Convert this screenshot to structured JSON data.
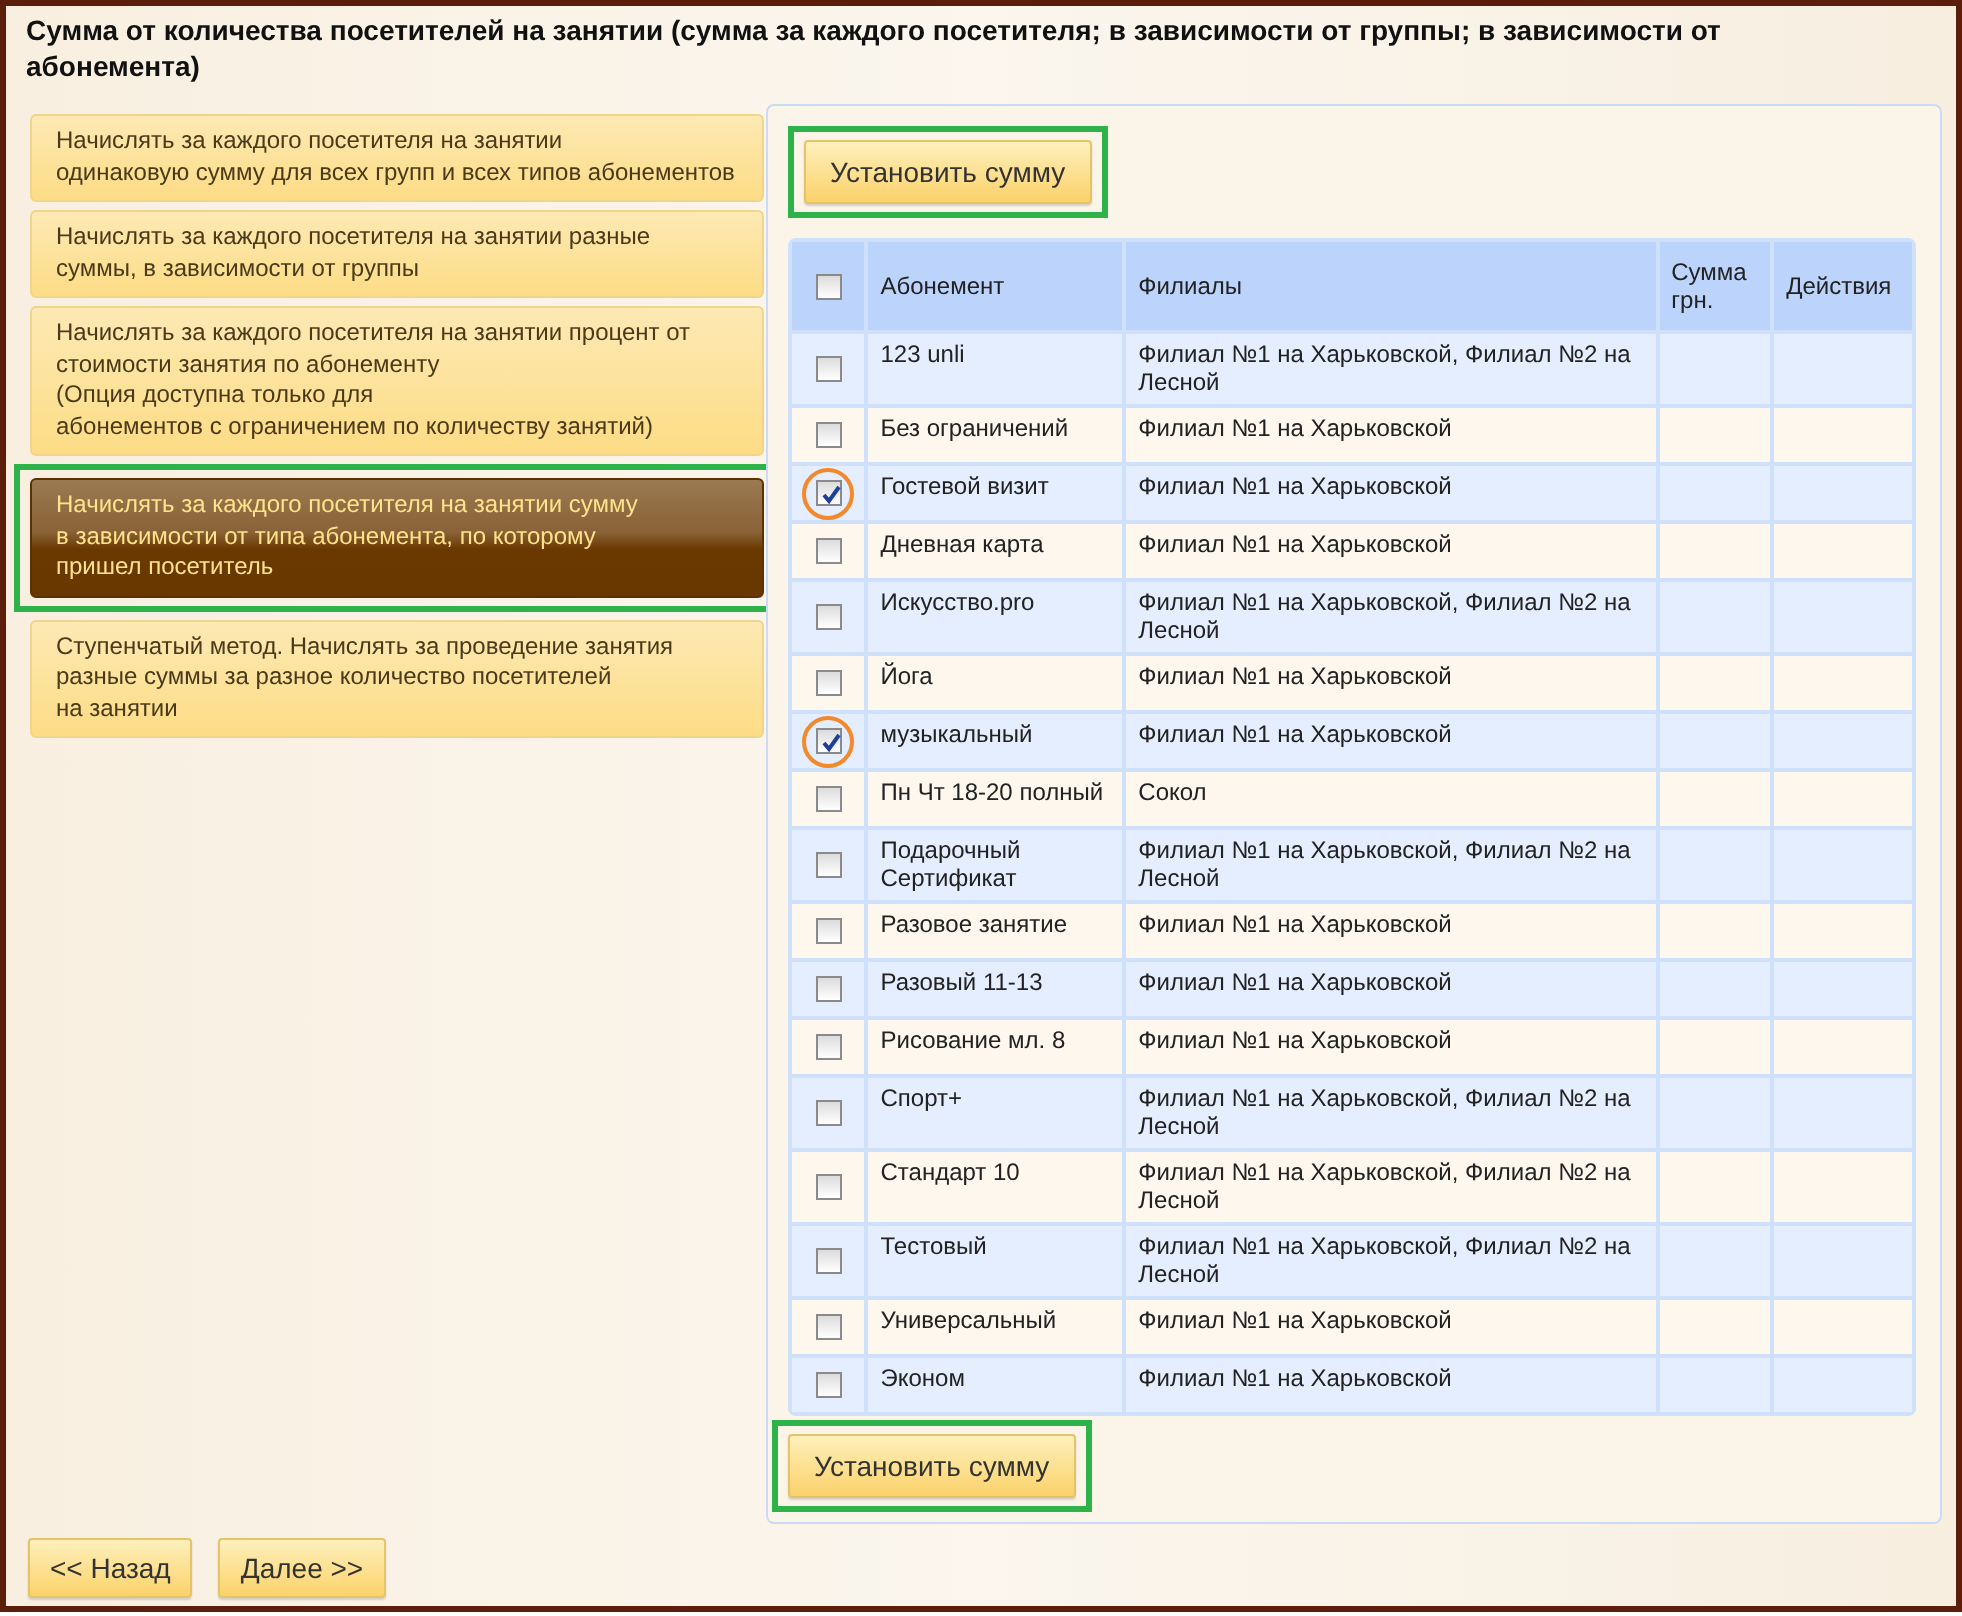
{
  "title": "Сумма от количества посетителей на занятии (сумма за каждого посетителя; в зависимости от группы; в зависимости от абонемента)",
  "options": [
    {
      "text": "Начислять за каждого посетителя на занятии\nодинаковую сумму для всех групп и всех типов абонементов",
      "selected": false,
      "highlighted": false
    },
    {
      "text": "Начислять за каждого посетителя на занятии разные\nсуммы, в зависимости от группы",
      "selected": false,
      "highlighted": false
    },
    {
      "text": "Начислять за каждого посетителя на занятии процент от\nстоимости занятия по абонементу\n(Опция доступна только для\nабонементов с ограничением по количеству занятий)",
      "selected": false,
      "highlighted": false
    },
    {
      "text": "Начислять за каждого посетителя на занятии сумму\nв зависимости от типа абонемента, по которому\nпришел посетитель",
      "selected": true,
      "highlighted": true
    },
    {
      "text": "Ступенчатый метод. Начислять за проведение занятия\nразные суммы за разное количество посетителей\nна занятии",
      "selected": false,
      "highlighted": false
    }
  ],
  "set_sum_top": {
    "label": "Установить сумму",
    "highlighted": true
  },
  "table": {
    "select_all_checked": false,
    "columns": [
      "Абонемент",
      "Филиалы",
      "Сумма\nгрн.",
      "Действия"
    ],
    "rows": [
      {
        "subscription": "123 unli",
        "branches": "Филиал №1 на Харьковской, Филиал №2 на Лесной",
        "checked": false,
        "circled": false
      },
      {
        "subscription": "Без ограничений",
        "branches": "Филиал №1 на Харьковской",
        "checked": false,
        "circled": false
      },
      {
        "subscription": "Гостевой визит",
        "branches": "Филиал №1 на Харьковской",
        "checked": true,
        "circled": true
      },
      {
        "subscription": "Дневная карта",
        "branches": "Филиал №1 на Харьковской",
        "checked": false,
        "circled": false
      },
      {
        "subscription": "Искусство.pro",
        "branches": "Филиал №1 на Харьковской, Филиал №2 на Лесной",
        "checked": false,
        "circled": false
      },
      {
        "subscription": "Йога",
        "branches": "Филиал №1 на Харьковской",
        "checked": false,
        "circled": false
      },
      {
        "subscription": "музыкальный",
        "branches": "Филиал №1 на Харьковской",
        "checked": true,
        "circled": true
      },
      {
        "subscription": "Пн Чт 18-20 полный",
        "branches": "Сокол",
        "checked": false,
        "circled": false
      },
      {
        "subscription": "Подарочный Сертификат",
        "branches": "Филиал №1 на Харьковской, Филиал №2 на Лесной",
        "checked": false,
        "circled": false
      },
      {
        "subscription": "Разовое занятие",
        "branches": "Филиал №1 на Харьковской",
        "checked": false,
        "circled": false
      },
      {
        "subscription": "Разовый 11-13",
        "branches": "Филиал №1 на Харьковской",
        "checked": false,
        "circled": false
      },
      {
        "subscription": "Рисование мл. 8",
        "branches": "Филиал №1 на Харьковской",
        "checked": false,
        "circled": false
      },
      {
        "subscription": "Спорт+",
        "branches": "Филиал №1 на Харьковской, Филиал №2 на Лесной",
        "checked": false,
        "circled": false
      },
      {
        "subscription": "Стандарт 10",
        "branches": "Филиал №1 на Харьковской, Филиал №2 на Лесной",
        "checked": false,
        "circled": false
      },
      {
        "subscription": "Тестовый",
        "branches": "Филиал №1 на Харьковской, Филиал №2 на Лесной",
        "checked": false,
        "circled": false
      },
      {
        "subscription": "Универсальный",
        "branches": "Филиал №1 на Харьковской",
        "checked": false,
        "circled": false
      },
      {
        "subscription": "Эконом",
        "branches": "Филиал №1 на Харьковской",
        "checked": false,
        "circled": false
      }
    ]
  },
  "set_sum_bottom": {
    "label": "Установить сумму",
    "highlighted": true
  },
  "nav_buttons": [
    "<< Назад",
    "Далее >>"
  ]
}
